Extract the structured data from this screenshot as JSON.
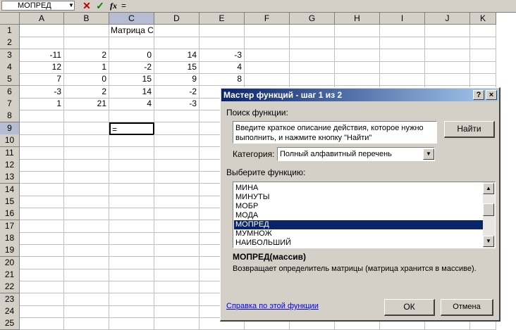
{
  "formula_bar": {
    "name_box": "МОПРЕД",
    "formula": "=",
    "icons": [
      "cancel-icon",
      "enter-icon",
      "insert-function-icon"
    ]
  },
  "columns": [
    "A",
    "B",
    "C",
    "D",
    "E",
    "F",
    "G",
    "H",
    "I",
    "J",
    "K"
  ],
  "rows": [
    "1",
    "2",
    "3",
    "4",
    "5",
    "6",
    "7",
    "8",
    "9",
    "10",
    "11",
    "12",
    "13",
    "14",
    "15",
    "16",
    "17",
    "18",
    "19",
    "20",
    "21",
    "22",
    "23",
    "24",
    "25"
  ],
  "cells": {
    "c1": "Матрица С",
    "r3": [
      "-11",
      "2",
      "0",
      "14",
      "-3"
    ],
    "r4": [
      "12",
      "1",
      "-2",
      "15",
      "4"
    ],
    "r5": [
      "7",
      "0",
      "15",
      "9",
      "8"
    ],
    "r6": [
      "-3",
      "2",
      "14",
      "-2",
      ""
    ],
    "r7": [
      "1",
      "21",
      "4",
      "-3",
      ""
    ],
    "c9": "="
  },
  "dialog": {
    "title": "Мастер функций - шаг 1 из 2",
    "help_btn": "?",
    "close_btn": "×",
    "search_label": "Поиск функции:",
    "search_value": "Введите краткое описание действия, которое нужно выполнить, и нажмите кнопку \"Найти\"",
    "find_button": "Найти",
    "category_label": "Категория:",
    "category_value": "Полный алфавитный перечень",
    "choose_label": "Выберите функцию:",
    "functions": [
      "МИНА",
      "МИНУТЫ",
      "МОБР",
      "МОДА",
      "МОПРЕД",
      "МУМНОЖ",
      "НАИБОЛЬШИЙ"
    ],
    "selected_function": "МОПРЕД",
    "signature": "МОПРЕД(массив)",
    "description": "Возвращает определитель матрицы (матрица хранится в массиве).",
    "help_link": "Справка по этой функции",
    "ok_button": "ОК",
    "cancel_button": "Отмена"
  }
}
